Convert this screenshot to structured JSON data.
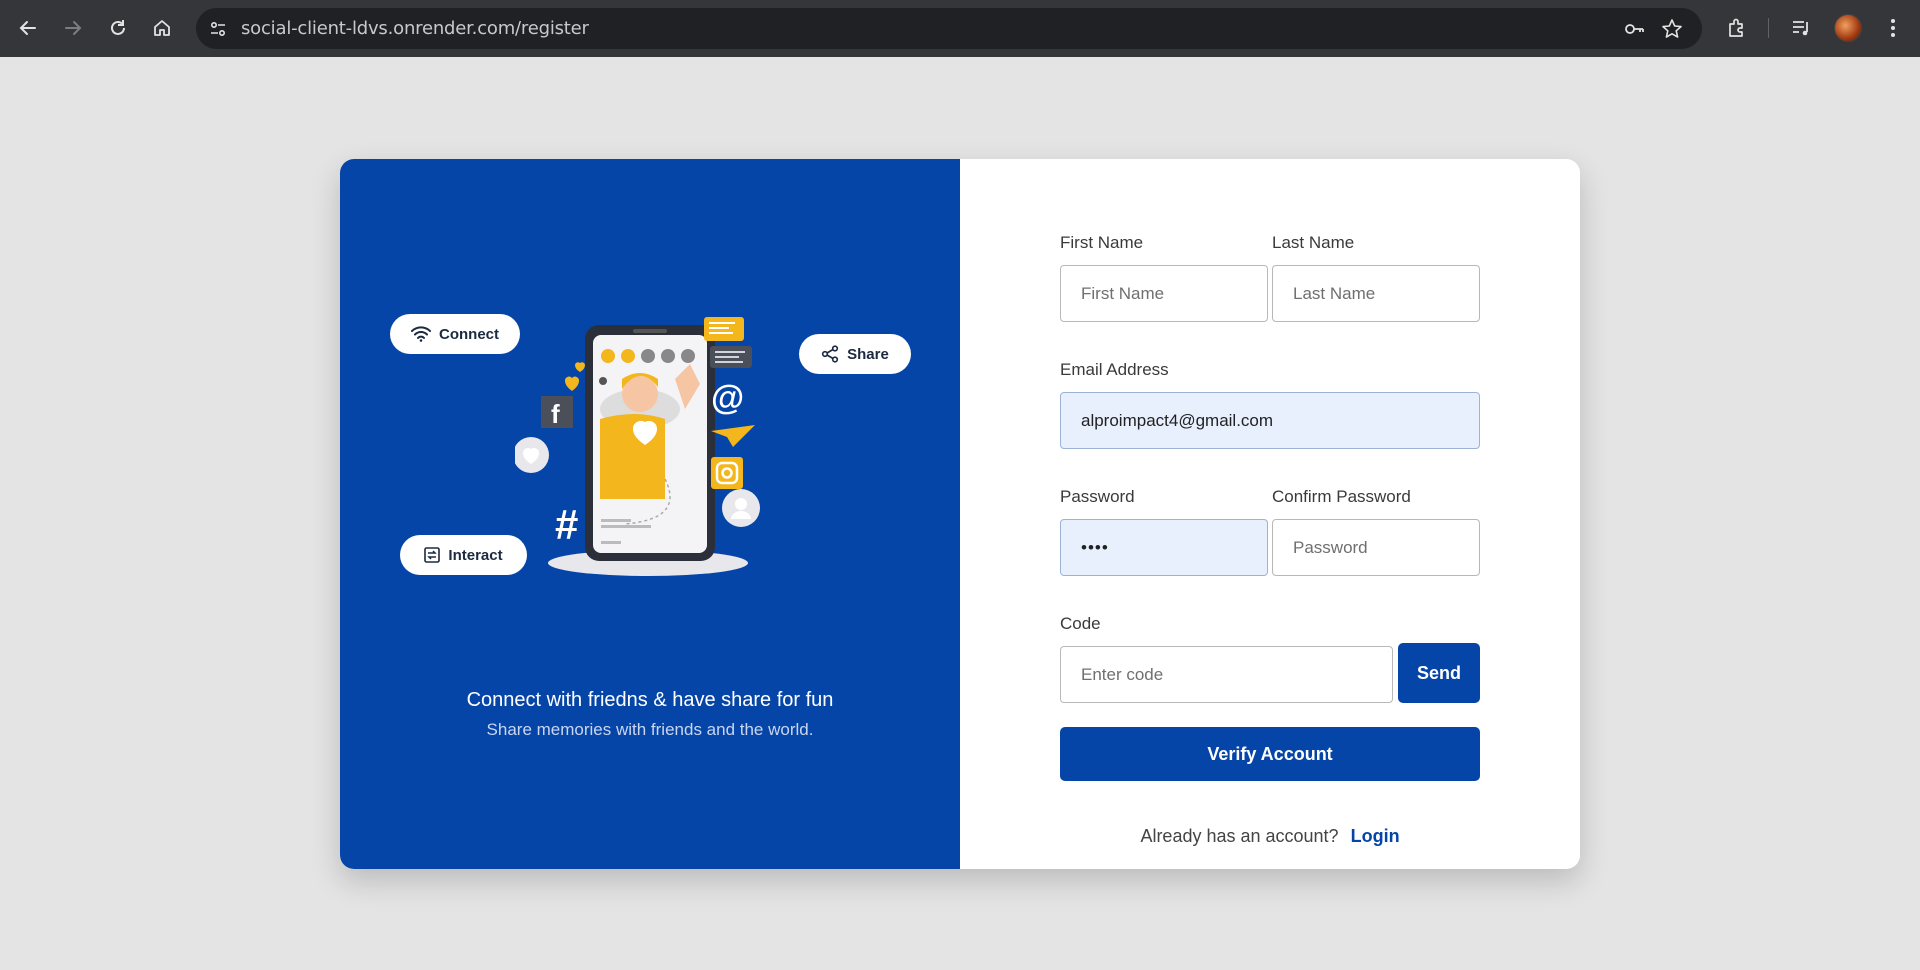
{
  "browser": {
    "url": "social-client-ldvs.onrender.com/register",
    "icons": [
      "back-icon",
      "forward-icon",
      "reload-icon",
      "home-icon",
      "site-settings-icon",
      "password-key-icon",
      "bookmark-star-icon",
      "extensions-icon",
      "media-playlist-icon",
      "profile-avatar",
      "menu-kebab-icon"
    ]
  },
  "hero": {
    "pills": {
      "connect": "Connect",
      "share": "Share",
      "interact": "Interact"
    },
    "tagline": "Connect with friedns & have share for fun",
    "subline": "Share memories with friends and the world."
  },
  "form": {
    "first_name": {
      "label": "First Name",
      "placeholder": "First Name",
      "value": ""
    },
    "last_name": {
      "label": "Last Name",
      "placeholder": "Last Name",
      "value": ""
    },
    "email": {
      "label": "Email Address",
      "placeholder": "",
      "value": "alproimpact4@gmail.com"
    },
    "password": {
      "label": "Password",
      "placeholder": "",
      "value": "••••"
    },
    "confirm_password": {
      "label": "Confirm Password",
      "placeholder": "Password",
      "value": ""
    },
    "code": {
      "label": "Code",
      "placeholder": "Enter code",
      "value": ""
    },
    "send_label": "Send",
    "verify_label": "Verify Account",
    "already_text": "Already has an account?",
    "login_label": "Login"
  },
  "colors": {
    "brand": "#0645a8",
    "autofill": "#e8f0fe",
    "page_bg": "#e4e4e4",
    "chrome_bg": "#35363a"
  }
}
